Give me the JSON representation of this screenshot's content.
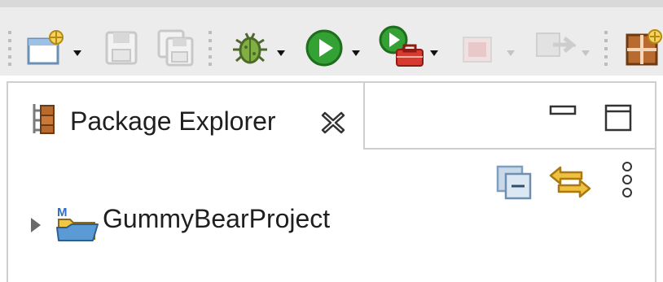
{
  "toolbar": {
    "items": [
      {
        "icon": "new-wizard-icon",
        "has_dropdown": true,
        "enabled": true
      },
      {
        "icon": "save-icon",
        "enabled": false
      },
      {
        "icon": "save-all-icon",
        "enabled": false
      },
      {
        "icon": "debug-icon",
        "has_dropdown": true,
        "enabled": true
      },
      {
        "icon": "run-icon",
        "has_dropdown": true,
        "enabled": true
      },
      {
        "icon": "external-tools-icon",
        "has_dropdown": true,
        "enabled": true
      },
      {
        "icon": "stop-icon",
        "has_dropdown": true,
        "enabled": false
      },
      {
        "icon": "skip-icon",
        "has_dropdown": true,
        "enabled": false
      },
      {
        "icon": "open-perspective-icon",
        "enabled": true
      }
    ]
  },
  "view": {
    "tab_title": "Package Explorer",
    "tab_icon": "package-explorer-icon",
    "close_icon": "close-icon",
    "minimize_icon": "minimize-icon",
    "maximize_icon": "maximize-icon",
    "actions": [
      "collapse-all-icon",
      "link-with-editor-icon",
      "view-menu-icon"
    ]
  },
  "tree": {
    "items": [
      {
        "label": "GummyBearProject",
        "expanded": false,
        "icon": "maven-project-folder-icon"
      }
    ]
  },
  "colors": {
    "toolbar_bg": "#ececec",
    "border": "#cfcfcf",
    "run_green": "#2e9b2e",
    "folder_blue": "#5b9bd5",
    "folder_yellow": "#f2c744"
  }
}
